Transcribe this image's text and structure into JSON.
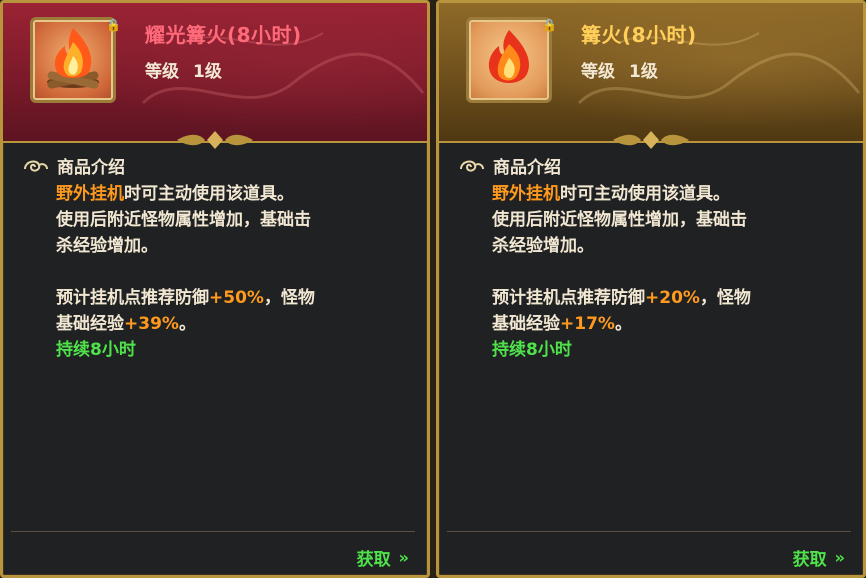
{
  "items": [
    {
      "title": "耀光篝火(8小时)",
      "level_label": "等级",
      "level_value": "1级",
      "section_title": "商品介绍",
      "desc_highlight": "野外挂机",
      "desc_line1_rest": "时可主动使用该道具。",
      "desc_line2": "使用后附近怪物属性增加，基础击",
      "desc_line3": "杀经验增加。",
      "bonus_prefix": "预计挂机点推荐防御",
      "bonus_defense": "+50%",
      "bonus_mid": "，怪物",
      "bonus_exp_prefix": "基础经验",
      "bonus_exp": "+39%",
      "bonus_end": "。",
      "duration": "持续8小时",
      "get_label": "获取",
      "get_arrow": "»",
      "icon": "campfire-icon",
      "theme_color": "#9b2334"
    },
    {
      "title": "篝火(8小时)",
      "level_label": "等级",
      "level_value": "1级",
      "section_title": "商品介绍",
      "desc_highlight": "野外挂机",
      "desc_line1_rest": "时可主动使用该道具。",
      "desc_line2": "使用后附近怪物属性增加，基础击",
      "desc_line3": "杀经验增加。",
      "bonus_prefix": "预计挂机点推荐防御",
      "bonus_defense": "+20%",
      "bonus_mid": "，怪物",
      "bonus_exp_prefix": "基础经验",
      "bonus_exp": "+17%",
      "bonus_end": "。",
      "duration": "持续8小时",
      "get_label": "获取",
      "get_arrow": "»",
      "icon": "flame-icon",
      "theme_color": "#8f6a28"
    }
  ]
}
